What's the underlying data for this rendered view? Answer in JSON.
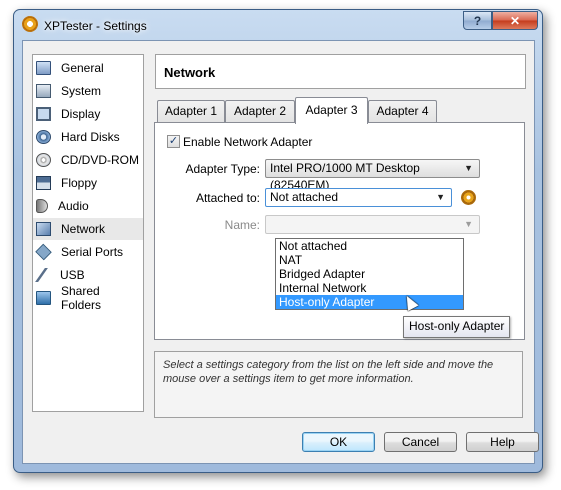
{
  "window": {
    "title": "XPTester - Settings",
    "help_glyph": "?",
    "close_glyph": "✕"
  },
  "sidebar": {
    "items": [
      {
        "label": "General",
        "icon": "general-icon"
      },
      {
        "label": "System",
        "icon": "system-icon"
      },
      {
        "label": "Display",
        "icon": "display-icon"
      },
      {
        "label": "Hard Disks",
        "icon": "hard-disk-icon"
      },
      {
        "label": "CD/DVD-ROM",
        "icon": "cd-dvd-icon"
      },
      {
        "label": "Floppy",
        "icon": "floppy-icon"
      },
      {
        "label": "Audio",
        "icon": "audio-icon"
      },
      {
        "label": "Network",
        "icon": "network-icon",
        "selected": true
      },
      {
        "label": "Serial Ports",
        "icon": "serial-ports-icon"
      },
      {
        "label": "USB",
        "icon": "usb-icon"
      },
      {
        "label": "Shared Folders",
        "icon": "shared-folders-icon"
      }
    ]
  },
  "header": {
    "title": "Network"
  },
  "tabs": [
    {
      "label": "Adapter 1"
    },
    {
      "label": "Adapter 2"
    },
    {
      "label": "Adapter 3",
      "active": true
    },
    {
      "label": "Adapter 4"
    }
  ],
  "adapter": {
    "enable_label": "Enable Network Adapter",
    "enable_checked": true,
    "check_glyph": "✓",
    "type_label": "Adapter Type:",
    "type_value": "Intel PRO/1000 MT Desktop (82540EM)",
    "attached_label": "Attached to:",
    "attached_value": "Not attached",
    "name_label": "Name:",
    "name_value": "",
    "arrow_glyph": "▼"
  },
  "dropdown": {
    "options": [
      "Not attached",
      "NAT",
      "Bridged Adapter",
      "Internal Network",
      "Host-only Adapter"
    ],
    "highlighted": "Host-only Adapter"
  },
  "tooltip": {
    "text": "Host-only Adapter"
  },
  "info": {
    "text": "Select a settings category from the list on the left side and move the mouse over a settings item to get more information."
  },
  "buttons": {
    "ok": "OK",
    "cancel": "Cancel",
    "help": "Help"
  },
  "colors": {
    "selection": "#3399ff",
    "title_bar": "#a9c3e0"
  }
}
